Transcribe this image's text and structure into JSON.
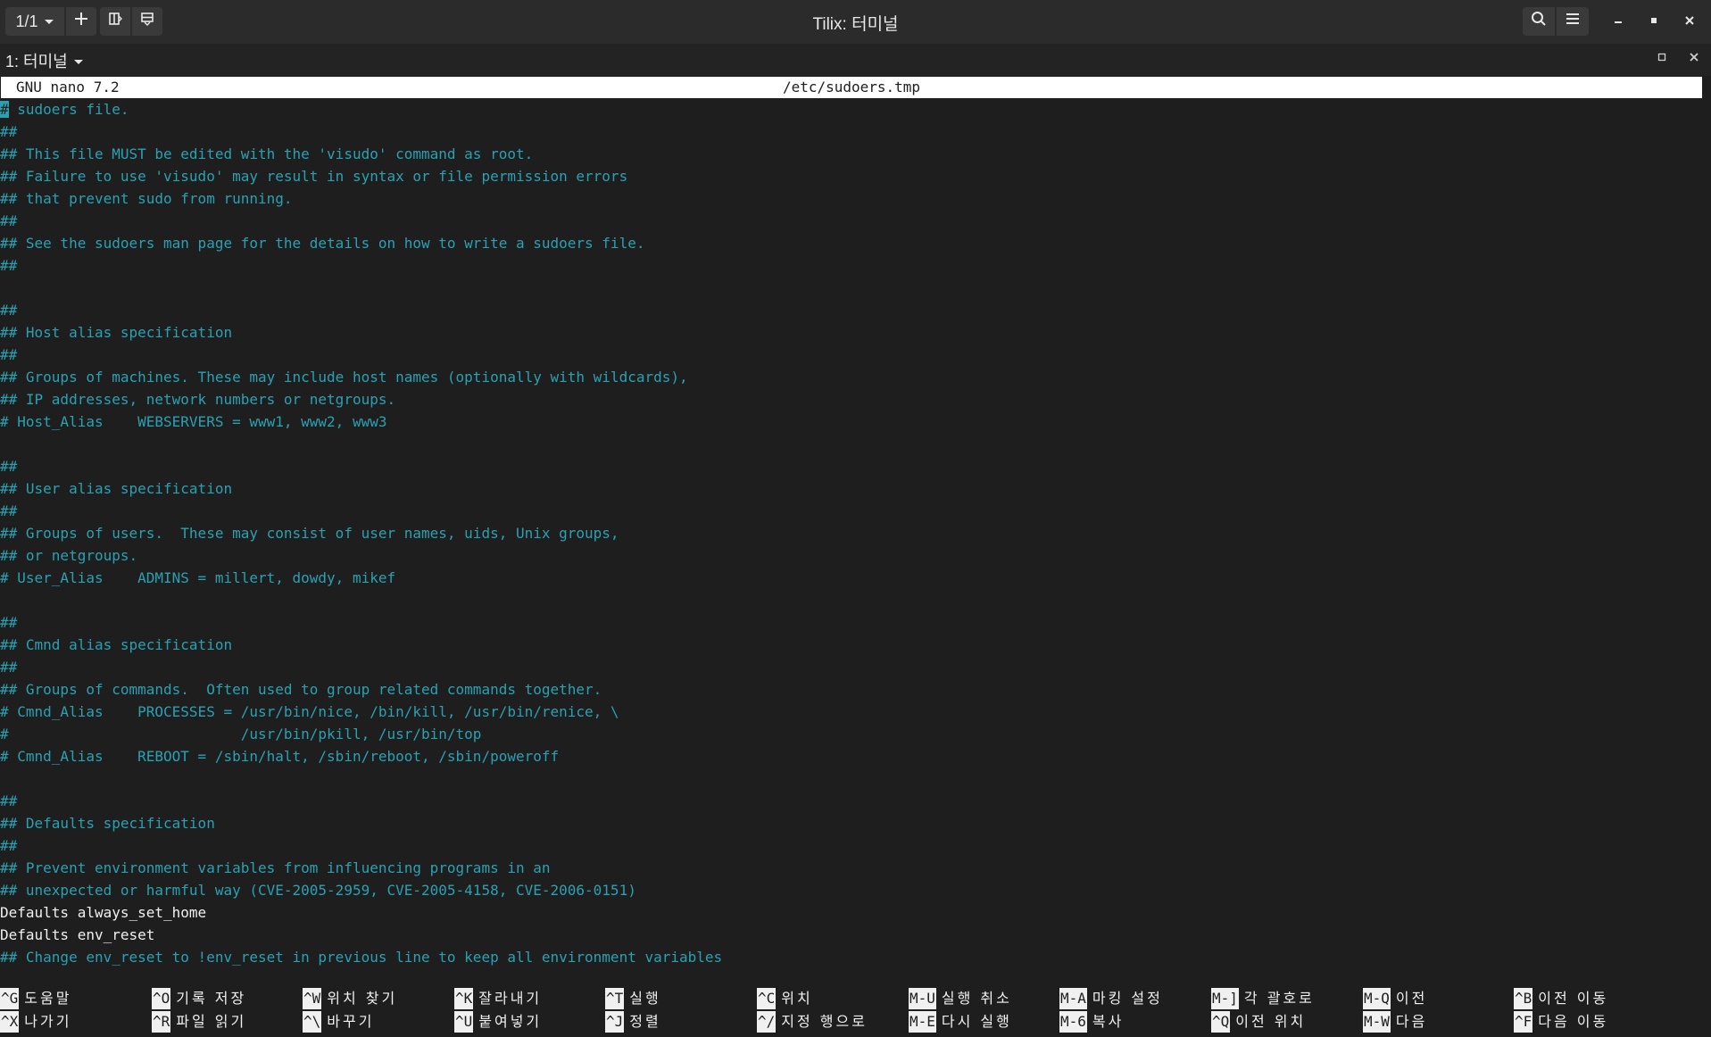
{
  "window": {
    "title": "Tilix: 터미널",
    "session_counter": "1/1",
    "session_tab": "1: 터미널"
  },
  "nano": {
    "version": "GNU nano 7.2",
    "filename": "/etc/sudoers.tmp"
  },
  "lines": [
    {
      "text": "# sudoers file.",
      "cls": "comment"
    },
    {
      "text": "##",
      "cls": "comment"
    },
    {
      "text": "## This file MUST be edited with the 'visudo' command as root.",
      "cls": "comment"
    },
    {
      "text": "## Failure to use 'visudo' may result in syntax or file permission errors",
      "cls": "comment"
    },
    {
      "text": "## that prevent sudo from running.",
      "cls": "comment"
    },
    {
      "text": "##",
      "cls": "comment"
    },
    {
      "text": "## See the sudoers man page for the details on how to write a sudoers file.",
      "cls": "comment"
    },
    {
      "text": "##",
      "cls": "comment"
    },
    {
      "text": "",
      "cls": "comment"
    },
    {
      "text": "##",
      "cls": "comment"
    },
    {
      "text": "## Host alias specification",
      "cls": "comment"
    },
    {
      "text": "##",
      "cls": "comment"
    },
    {
      "text": "## Groups of machines. These may include host names (optionally with wildcards),",
      "cls": "comment"
    },
    {
      "text": "## IP addresses, network numbers or netgroups.",
      "cls": "comment"
    },
    {
      "text": "# Host_Alias    WEBSERVERS = www1, www2, www3",
      "cls": "comment"
    },
    {
      "text": "",
      "cls": "comment"
    },
    {
      "text": "##",
      "cls": "comment"
    },
    {
      "text": "## User alias specification",
      "cls": "comment"
    },
    {
      "text": "##",
      "cls": "comment"
    },
    {
      "text": "## Groups of users.  These may consist of user names, uids, Unix groups,",
      "cls": "comment"
    },
    {
      "text": "## or netgroups.",
      "cls": "comment"
    },
    {
      "text": "# User_Alias    ADMINS = millert, dowdy, mikef",
      "cls": "comment"
    },
    {
      "text": "",
      "cls": "comment"
    },
    {
      "text": "##",
      "cls": "comment"
    },
    {
      "text": "## Cmnd alias specification",
      "cls": "comment"
    },
    {
      "text": "##",
      "cls": "comment"
    },
    {
      "text": "## Groups of commands.  Often used to group related commands together.",
      "cls": "comment"
    },
    {
      "text": "# Cmnd_Alias    PROCESSES = /usr/bin/nice, /bin/kill, /usr/bin/renice, \\",
      "cls": "comment"
    },
    {
      "text": "#                           /usr/bin/pkill, /usr/bin/top",
      "cls": "comment"
    },
    {
      "text": "# Cmnd_Alias    REBOOT = /sbin/halt, /sbin/reboot, /sbin/poweroff",
      "cls": "comment"
    },
    {
      "text": "",
      "cls": "comment"
    },
    {
      "text": "##",
      "cls": "comment"
    },
    {
      "text": "## Defaults specification",
      "cls": "comment"
    },
    {
      "text": "##",
      "cls": "comment"
    },
    {
      "text": "## Prevent environment variables from influencing programs in an",
      "cls": "comment"
    },
    {
      "text": "## unexpected or harmful way (CVE-2005-2959, CVE-2005-4158, CVE-2006-0151)",
      "cls": "comment"
    },
    {
      "text": "Defaults always_set_home",
      "cls": "plain"
    },
    {
      "text": "Defaults env_reset",
      "cls": "plain"
    },
    {
      "text": "## Change env_reset to !env_reset in previous line to keep all environment variables",
      "cls": "comment"
    }
  ],
  "shortcuts": [
    {
      "key": "^G",
      "label": "도움말"
    },
    {
      "key": "^X",
      "label": "나가기"
    },
    {
      "key": "^O",
      "label": "기록 저장"
    },
    {
      "key": "^R",
      "label": "파일 읽기"
    },
    {
      "key": "^W",
      "label": "위치 찾기"
    },
    {
      "key": "^\\",
      "label": "바꾸기"
    },
    {
      "key": "^K",
      "label": "잘라내기"
    },
    {
      "key": "^U",
      "label": "붙여넣기"
    },
    {
      "key": "^T",
      "label": "실행"
    },
    {
      "key": "^J",
      "label": "정렬"
    },
    {
      "key": "^C",
      "label": "위치"
    },
    {
      "key": "^/",
      "label": "지정 행으로"
    },
    {
      "key": "M-U",
      "label": "실행 취소"
    },
    {
      "key": "M-E",
      "label": "다시 실행"
    },
    {
      "key": "M-A",
      "label": "마킹 설정"
    },
    {
      "key": "M-6",
      "label": "복사"
    },
    {
      "key": "M-]",
      "label": "각 괄호로"
    },
    {
      "key": "^Q",
      "label": "이전 위치"
    },
    {
      "key": "M-Q",
      "label": "이전"
    },
    {
      "key": "M-W",
      "label": "다음"
    },
    {
      "key": "^B",
      "label": "이전 이동"
    },
    {
      "key": "^F",
      "label": "다음 이동"
    }
  ]
}
